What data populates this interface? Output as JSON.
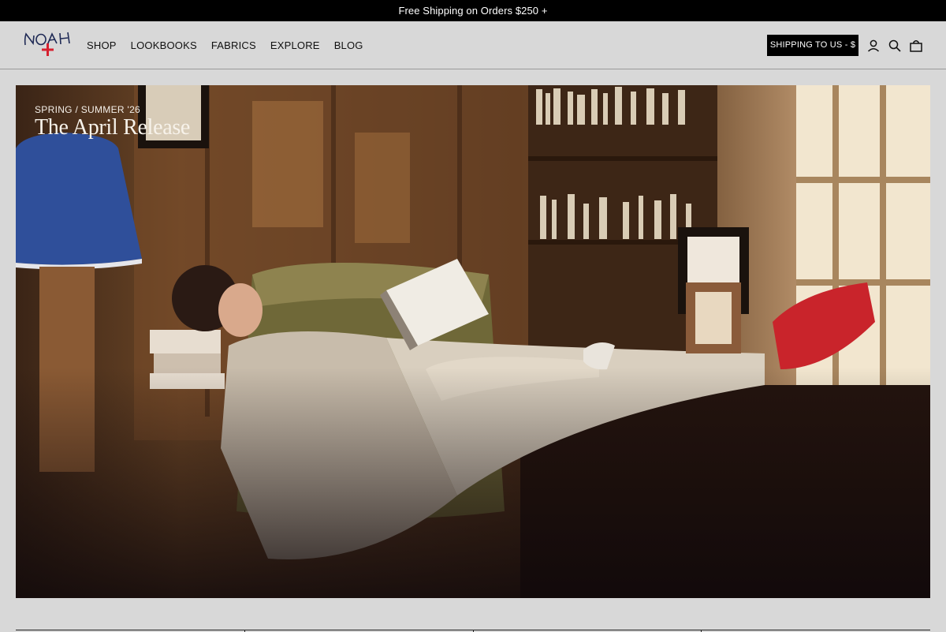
{
  "announcement": {
    "text": "Free Shipping on Orders $250 +"
  },
  "header": {
    "logo_text": "NOAH",
    "nav": [
      {
        "label": "SHOP"
      },
      {
        "label": "LOOKBOOKS"
      },
      {
        "label": "FABRICS"
      },
      {
        "label": "EXPLORE"
      },
      {
        "label": "BLOG"
      }
    ],
    "shipping_button": "SHIPPING TO US - $",
    "icons": [
      "account-icon",
      "search-icon",
      "shopping-bag-icon"
    ]
  },
  "hero": {
    "eyebrow": "SPRING / SUMMER '26",
    "title": "The April Release"
  },
  "colors": {
    "background": "#d8d8d8",
    "bar": "#000000",
    "accent_red": "#d6202f",
    "logo_navy": "#1f2a55"
  }
}
